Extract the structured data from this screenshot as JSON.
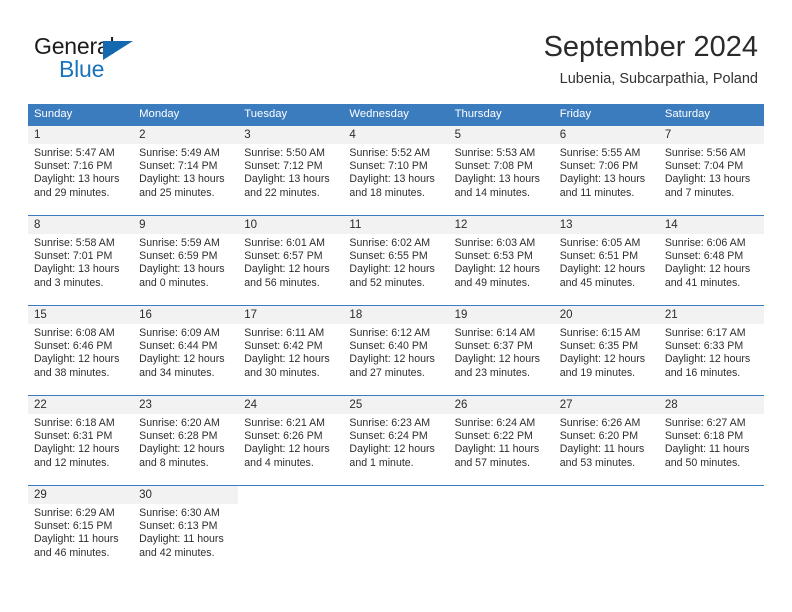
{
  "logo": {
    "primary_text": "General",
    "secondary_text": "Blue",
    "primary_color": "#1c1c1c",
    "secondary_color": "#1a73bb",
    "triangle_color": "#1468b0"
  },
  "header": {
    "title": "September 2024",
    "subtitle": "Lubenia, Subcarpathia, Poland"
  },
  "theme": {
    "header_bg": "#3a7cbe",
    "header_text": "#ffffff",
    "daynum_bg": "#f2f2f2",
    "row_divider": "#3a7cbe",
    "body_text": "#2e2e2e"
  },
  "weekdays": [
    "Sunday",
    "Monday",
    "Tuesday",
    "Wednesday",
    "Thursday",
    "Friday",
    "Saturday"
  ],
  "weeks": [
    [
      {
        "day": "1",
        "sunrise": "Sunrise: 5:47 AM",
        "sunset": "Sunset: 7:16 PM",
        "daylight_line1": "Daylight: 13 hours",
        "daylight_line2": "and 29 minutes."
      },
      {
        "day": "2",
        "sunrise": "Sunrise: 5:49 AM",
        "sunset": "Sunset: 7:14 PM",
        "daylight_line1": "Daylight: 13 hours",
        "daylight_line2": "and 25 minutes."
      },
      {
        "day": "3",
        "sunrise": "Sunrise: 5:50 AM",
        "sunset": "Sunset: 7:12 PM",
        "daylight_line1": "Daylight: 13 hours",
        "daylight_line2": "and 22 minutes."
      },
      {
        "day": "4",
        "sunrise": "Sunrise: 5:52 AM",
        "sunset": "Sunset: 7:10 PM",
        "daylight_line1": "Daylight: 13 hours",
        "daylight_line2": "and 18 minutes."
      },
      {
        "day": "5",
        "sunrise": "Sunrise: 5:53 AM",
        "sunset": "Sunset: 7:08 PM",
        "daylight_line1": "Daylight: 13 hours",
        "daylight_line2": "and 14 minutes."
      },
      {
        "day": "6",
        "sunrise": "Sunrise: 5:55 AM",
        "sunset": "Sunset: 7:06 PM",
        "daylight_line1": "Daylight: 13 hours",
        "daylight_line2": "and 11 minutes."
      },
      {
        "day": "7",
        "sunrise": "Sunrise: 5:56 AM",
        "sunset": "Sunset: 7:04 PM",
        "daylight_line1": "Daylight: 13 hours",
        "daylight_line2": "and 7 minutes."
      }
    ],
    [
      {
        "day": "8",
        "sunrise": "Sunrise: 5:58 AM",
        "sunset": "Sunset: 7:01 PM",
        "daylight_line1": "Daylight: 13 hours",
        "daylight_line2": "and 3 minutes."
      },
      {
        "day": "9",
        "sunrise": "Sunrise: 5:59 AM",
        "sunset": "Sunset: 6:59 PM",
        "daylight_line1": "Daylight: 13 hours",
        "daylight_line2": "and 0 minutes."
      },
      {
        "day": "10",
        "sunrise": "Sunrise: 6:01 AM",
        "sunset": "Sunset: 6:57 PM",
        "daylight_line1": "Daylight: 12 hours",
        "daylight_line2": "and 56 minutes."
      },
      {
        "day": "11",
        "sunrise": "Sunrise: 6:02 AM",
        "sunset": "Sunset: 6:55 PM",
        "daylight_line1": "Daylight: 12 hours",
        "daylight_line2": "and 52 minutes."
      },
      {
        "day": "12",
        "sunrise": "Sunrise: 6:03 AM",
        "sunset": "Sunset: 6:53 PM",
        "daylight_line1": "Daylight: 12 hours",
        "daylight_line2": "and 49 minutes."
      },
      {
        "day": "13",
        "sunrise": "Sunrise: 6:05 AM",
        "sunset": "Sunset: 6:51 PM",
        "daylight_line1": "Daylight: 12 hours",
        "daylight_line2": "and 45 minutes."
      },
      {
        "day": "14",
        "sunrise": "Sunrise: 6:06 AM",
        "sunset": "Sunset: 6:48 PM",
        "daylight_line1": "Daylight: 12 hours",
        "daylight_line2": "and 41 minutes."
      }
    ],
    [
      {
        "day": "15",
        "sunrise": "Sunrise: 6:08 AM",
        "sunset": "Sunset: 6:46 PM",
        "daylight_line1": "Daylight: 12 hours",
        "daylight_line2": "and 38 minutes."
      },
      {
        "day": "16",
        "sunrise": "Sunrise: 6:09 AM",
        "sunset": "Sunset: 6:44 PM",
        "daylight_line1": "Daylight: 12 hours",
        "daylight_line2": "and 34 minutes."
      },
      {
        "day": "17",
        "sunrise": "Sunrise: 6:11 AM",
        "sunset": "Sunset: 6:42 PM",
        "daylight_line1": "Daylight: 12 hours",
        "daylight_line2": "and 30 minutes."
      },
      {
        "day": "18",
        "sunrise": "Sunrise: 6:12 AM",
        "sunset": "Sunset: 6:40 PM",
        "daylight_line1": "Daylight: 12 hours",
        "daylight_line2": "and 27 minutes."
      },
      {
        "day": "19",
        "sunrise": "Sunrise: 6:14 AM",
        "sunset": "Sunset: 6:37 PM",
        "daylight_line1": "Daylight: 12 hours",
        "daylight_line2": "and 23 minutes."
      },
      {
        "day": "20",
        "sunrise": "Sunrise: 6:15 AM",
        "sunset": "Sunset: 6:35 PM",
        "daylight_line1": "Daylight: 12 hours",
        "daylight_line2": "and 19 minutes."
      },
      {
        "day": "21",
        "sunrise": "Sunrise: 6:17 AM",
        "sunset": "Sunset: 6:33 PM",
        "daylight_line1": "Daylight: 12 hours",
        "daylight_line2": "and 16 minutes."
      }
    ],
    [
      {
        "day": "22",
        "sunrise": "Sunrise: 6:18 AM",
        "sunset": "Sunset: 6:31 PM",
        "daylight_line1": "Daylight: 12 hours",
        "daylight_line2": "and 12 minutes."
      },
      {
        "day": "23",
        "sunrise": "Sunrise: 6:20 AM",
        "sunset": "Sunset: 6:28 PM",
        "daylight_line1": "Daylight: 12 hours",
        "daylight_line2": "and 8 minutes."
      },
      {
        "day": "24",
        "sunrise": "Sunrise: 6:21 AM",
        "sunset": "Sunset: 6:26 PM",
        "daylight_line1": "Daylight: 12 hours",
        "daylight_line2": "and 4 minutes."
      },
      {
        "day": "25",
        "sunrise": "Sunrise: 6:23 AM",
        "sunset": "Sunset: 6:24 PM",
        "daylight_line1": "Daylight: 12 hours",
        "daylight_line2": "and 1 minute."
      },
      {
        "day": "26",
        "sunrise": "Sunrise: 6:24 AM",
        "sunset": "Sunset: 6:22 PM",
        "daylight_line1": "Daylight: 11 hours",
        "daylight_line2": "and 57 minutes."
      },
      {
        "day": "27",
        "sunrise": "Sunrise: 6:26 AM",
        "sunset": "Sunset: 6:20 PM",
        "daylight_line1": "Daylight: 11 hours",
        "daylight_line2": "and 53 minutes."
      },
      {
        "day": "28",
        "sunrise": "Sunrise: 6:27 AM",
        "sunset": "Sunset: 6:18 PM",
        "daylight_line1": "Daylight: 11 hours",
        "daylight_line2": "and 50 minutes."
      }
    ],
    [
      {
        "day": "29",
        "sunrise": "Sunrise: 6:29 AM",
        "sunset": "Sunset: 6:15 PM",
        "daylight_line1": "Daylight: 11 hours",
        "daylight_line2": "and 46 minutes."
      },
      {
        "day": "30",
        "sunrise": "Sunrise: 6:30 AM",
        "sunset": "Sunset: 6:13 PM",
        "daylight_line1": "Daylight: 11 hours",
        "daylight_line2": "and 42 minutes."
      },
      {
        "day": "",
        "sunrise": "",
        "sunset": "",
        "daylight_line1": "",
        "daylight_line2": ""
      },
      {
        "day": "",
        "sunrise": "",
        "sunset": "",
        "daylight_line1": "",
        "daylight_line2": ""
      },
      {
        "day": "",
        "sunrise": "",
        "sunset": "",
        "daylight_line1": "",
        "daylight_line2": ""
      },
      {
        "day": "",
        "sunrise": "",
        "sunset": "",
        "daylight_line1": "",
        "daylight_line2": ""
      },
      {
        "day": "",
        "sunrise": "",
        "sunset": "",
        "daylight_line1": "",
        "daylight_line2": ""
      }
    ]
  ]
}
